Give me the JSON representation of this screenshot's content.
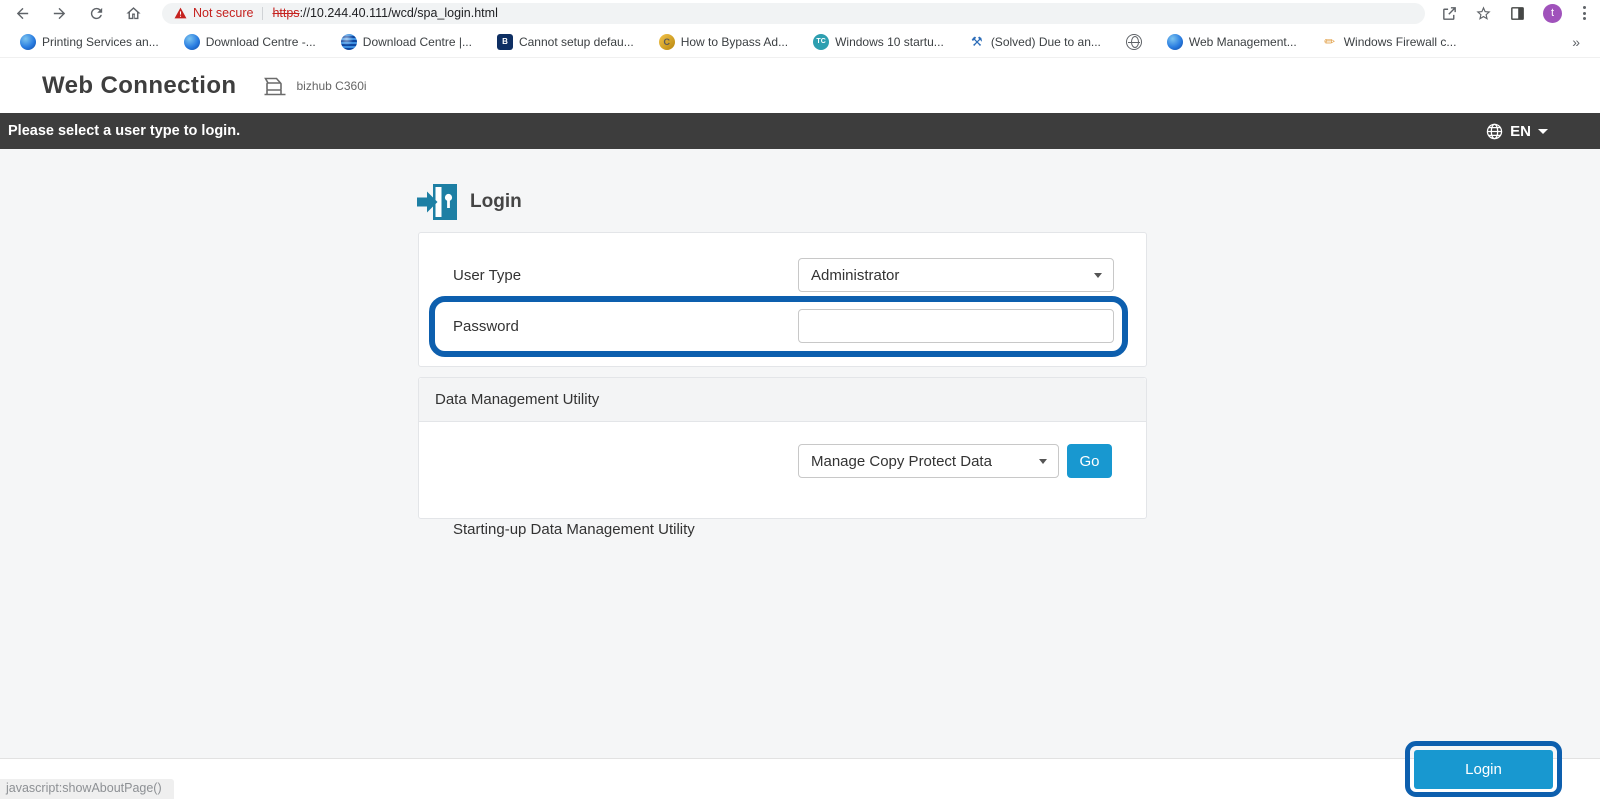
{
  "browser": {
    "not_secure_label": "Not secure",
    "url_scheme": "https",
    "url_rest": "://10.244.40.111/wcd/spa_login.html",
    "avatar_letter": "t",
    "overflow_chevron": "»",
    "bookmarks": [
      {
        "icon": "globe-blue-icon",
        "glyph": "",
        "label": "Printing Services an..."
      },
      {
        "icon": "globe-blue-icon",
        "glyph": "",
        "label": "Download Centre -..."
      },
      {
        "icon": "globe-striped-icon",
        "glyph": "",
        "label": "Download Centre |..."
      },
      {
        "icon": "navy-square-icon",
        "glyph": "B",
        "label": "Cannot setup defau..."
      },
      {
        "icon": "gold-badge-icon",
        "glyph": "C",
        "label": "How to Bypass Ad..."
      },
      {
        "icon": "teal-circle-icon",
        "glyph": "TC",
        "label": "Windows 10 startu..."
      },
      {
        "icon": "blue-tool-icon",
        "glyph": "⚒",
        "label": "(Solved) Due to an..."
      },
      {
        "icon": "gray-globe-icon",
        "glyph": "",
        "label": ""
      },
      {
        "icon": "globe-blue-icon",
        "glyph": "",
        "label": "Web Management..."
      },
      {
        "icon": "pencil-icon",
        "glyph": "✏",
        "label": "Windows Firewall c..."
      }
    ]
  },
  "site_header": {
    "logo": "Web Connection",
    "device_name": "bizhub C360i"
  },
  "banner": {
    "message": "Please select a user type to login.",
    "language_code": "EN"
  },
  "login_panel": {
    "title": "Login",
    "user_type_label": "User Type",
    "user_type_value": "Administrator",
    "password_label": "Password",
    "password_value": ""
  },
  "data_management": {
    "section_title": "Data Management Utility",
    "label": "Starting-up Data Management Utility",
    "selected_option": "Manage Copy Protect Data",
    "go_button_label": "Go"
  },
  "footer": {
    "login_button_label": "Login",
    "status_text": "javascript:showAboutPage()"
  },
  "colors": {
    "accent_blue": "#1898d0",
    "highlight_blue": "#0d5fae",
    "banner_dark": "#3d3d3d",
    "login_icon_teal": "#1d7fa4",
    "not_secure_red": "#c5221f"
  }
}
